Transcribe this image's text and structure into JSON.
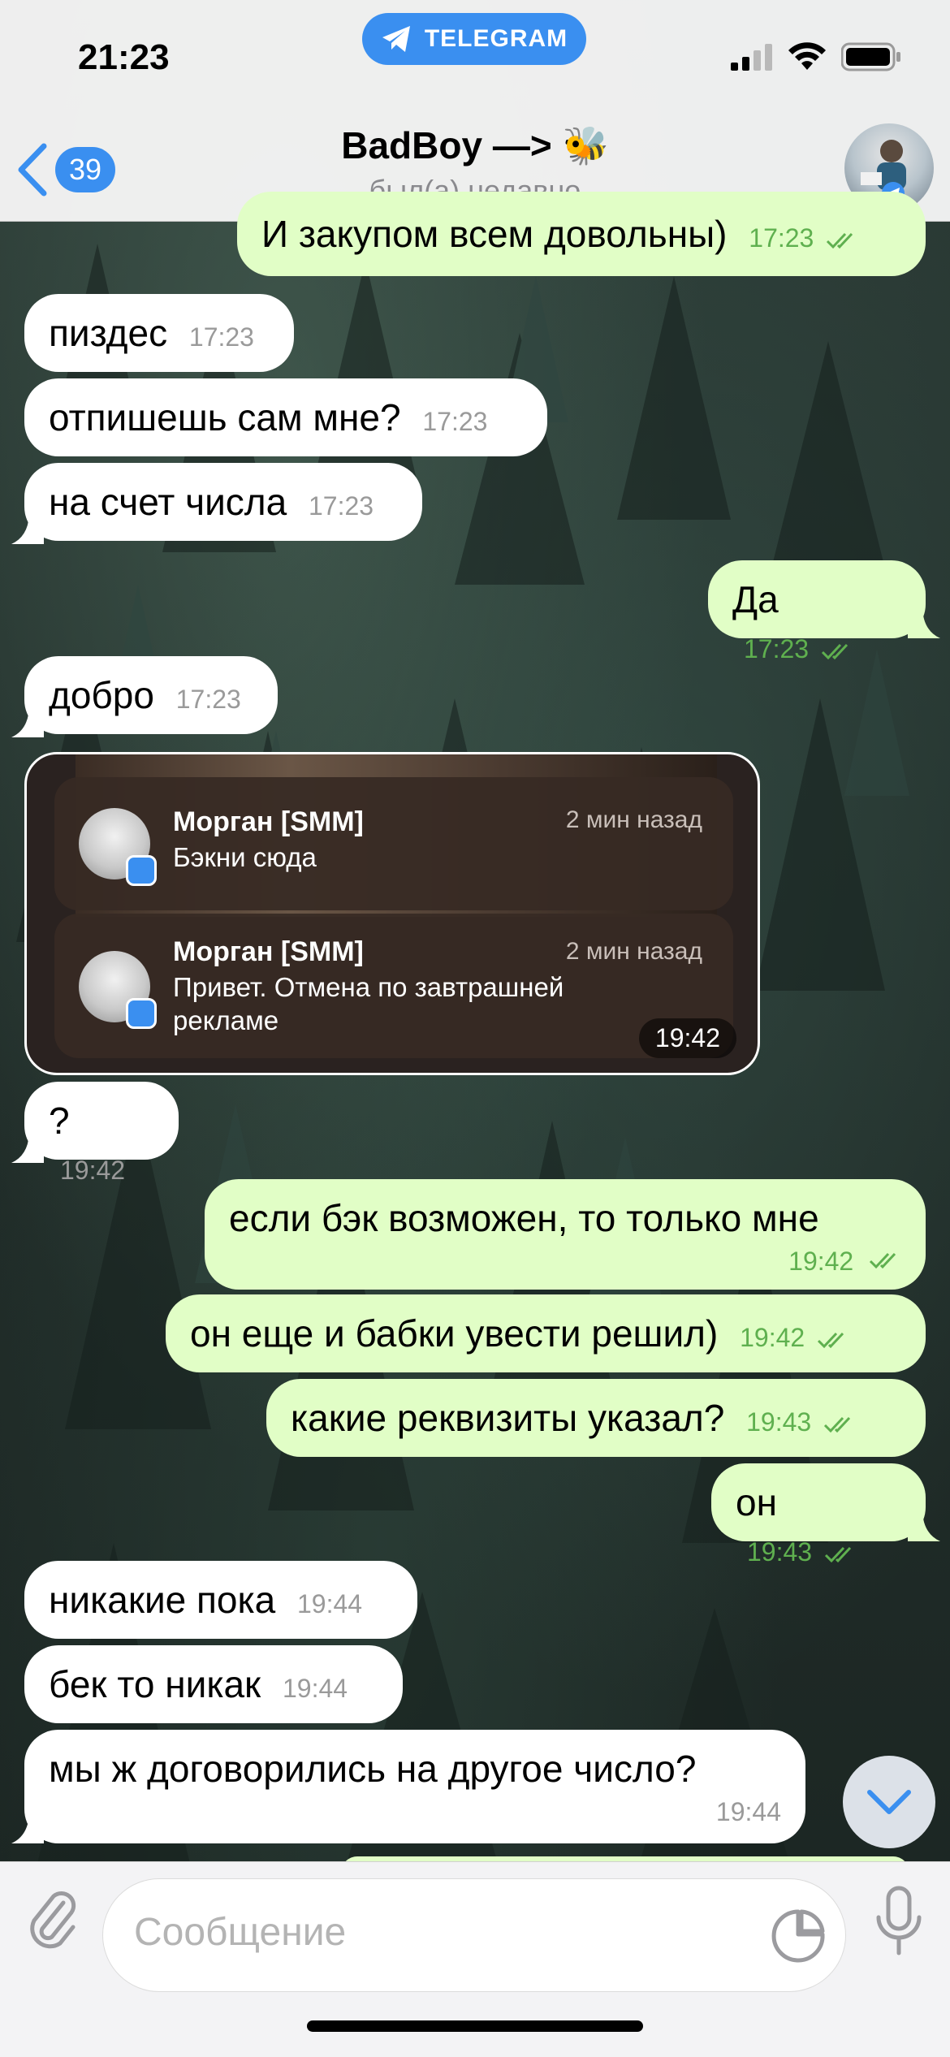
{
  "status_bar": {
    "time": "21:23",
    "app_pill": "TELEGRAM"
  },
  "header": {
    "back_count": "39",
    "title": "BadBoy —> ",
    "title_emoji": "🐝",
    "subtitle": "был(а) недавно"
  },
  "messages": [
    {
      "dir": "out",
      "text": "И закупом всем довольны)",
      "time": "17:23"
    },
    {
      "dir": "in",
      "text": "пиздес",
      "time": "17:23"
    },
    {
      "dir": "in",
      "text": "отпишешь сам мне?",
      "time": "17:23"
    },
    {
      "dir": "in",
      "text": "на счет числа",
      "time": "17:23"
    },
    {
      "dir": "out",
      "text": "Да",
      "time": "17:23"
    },
    {
      "dir": "in",
      "text": "добро",
      "time": "17:23"
    },
    {
      "dir": "in",
      "text": "?",
      "time": "19:42"
    },
    {
      "dir": "out",
      "text": "если бэк возможен, то только мне",
      "time": "19:42"
    },
    {
      "dir": "out",
      "text": "он еще и бабки увести решил)",
      "time": "19:42"
    },
    {
      "dir": "out",
      "text": "какие реквизиты указал?",
      "time": "19:43"
    },
    {
      "dir": "out",
      "text": "он",
      "time": "19:43"
    },
    {
      "dir": "in",
      "text": "никакие пока",
      "time": "19:44"
    },
    {
      "dir": "in",
      "text": "бек то никак",
      "time": "19:44"
    },
    {
      "dir": "in",
      "text": "мы ж договорились на другое число?",
      "time": "19:44"
    }
  ],
  "screenshot_card": {
    "time": "19:42",
    "notifications": [
      {
        "name": "Морган [SMM]",
        "ago": "2 мин назад",
        "text": "Бэкни сюда"
      },
      {
        "name": "Морган [SMM]",
        "ago": "2 мин назад",
        "text": "Привет. Отмена по завтрашней рекламе"
      }
    ]
  },
  "input": {
    "placeholder": "Сообщение"
  },
  "colors": {
    "accent": "#3a8ff0",
    "outgoing_bubble": "#e1fec6",
    "incoming_bubble": "#ffffff",
    "read_check": "#5fb04f"
  }
}
